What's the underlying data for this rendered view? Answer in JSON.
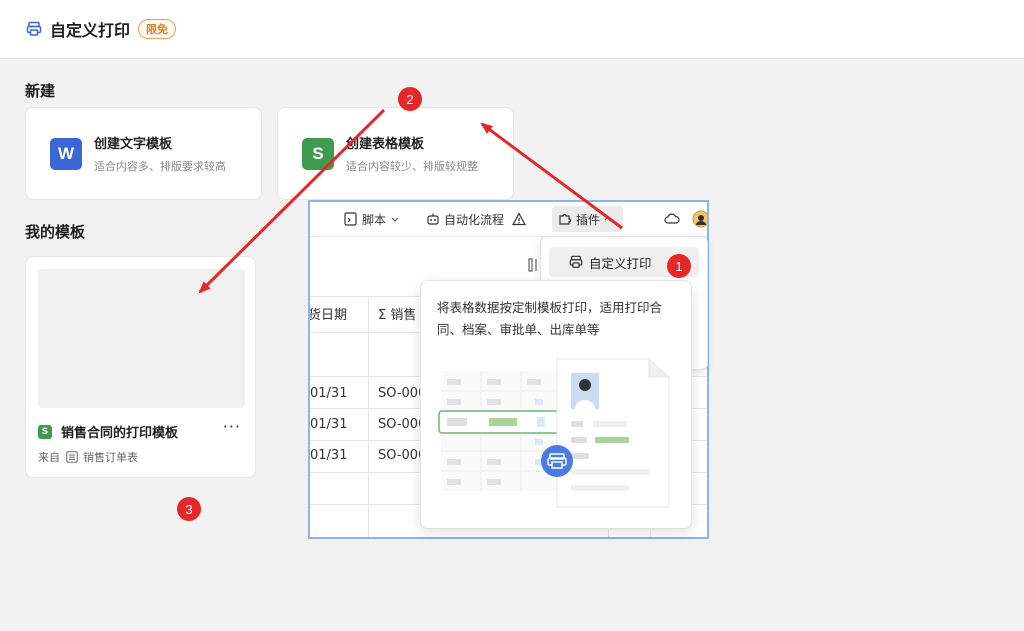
{
  "header": {
    "title": "自定义打印",
    "badge": "限免"
  },
  "sections": {
    "new": "新建",
    "my_templates": "我的模板"
  },
  "create_cards": [
    {
      "icon_letter": "W",
      "icon_color": "#3b66d6",
      "title": "创建文字模板",
      "desc": "适合内容多、排版要求较高"
    },
    {
      "icon_letter": "S",
      "icon_color": "#3f9b4f",
      "title": "创建表格模板",
      "desc": "适合内容较少、排版较规整"
    }
  ],
  "template": {
    "name": "销售合同的打印模板",
    "more": "···",
    "from_label": "来自",
    "source_name": "销售订单表"
  },
  "overlay": {
    "toolbar": {
      "script": "脚本",
      "automation": "自动化流程",
      "plugin": "插件"
    },
    "columns": {
      "date_partial": "货日期",
      "sales_partial": "Σ 销售"
    },
    "rows": [
      {
        "date": "01/31",
        "code": "SO-000"
      },
      {
        "date": "01/31",
        "code": "SO-000"
      },
      {
        "date": "01/31",
        "code": "SO-000"
      }
    ],
    "dropdown_item": "自定义打印",
    "tooltip_text": "将表格数据按定制模板打印，适用打印合同、档案、审批单、出库单等"
  },
  "annotations": [
    "1",
    "2",
    "3"
  ],
  "colors": {
    "accent_red": "#e52727",
    "print_blue": "#4a7be0",
    "green": "#3f9b4f"
  }
}
